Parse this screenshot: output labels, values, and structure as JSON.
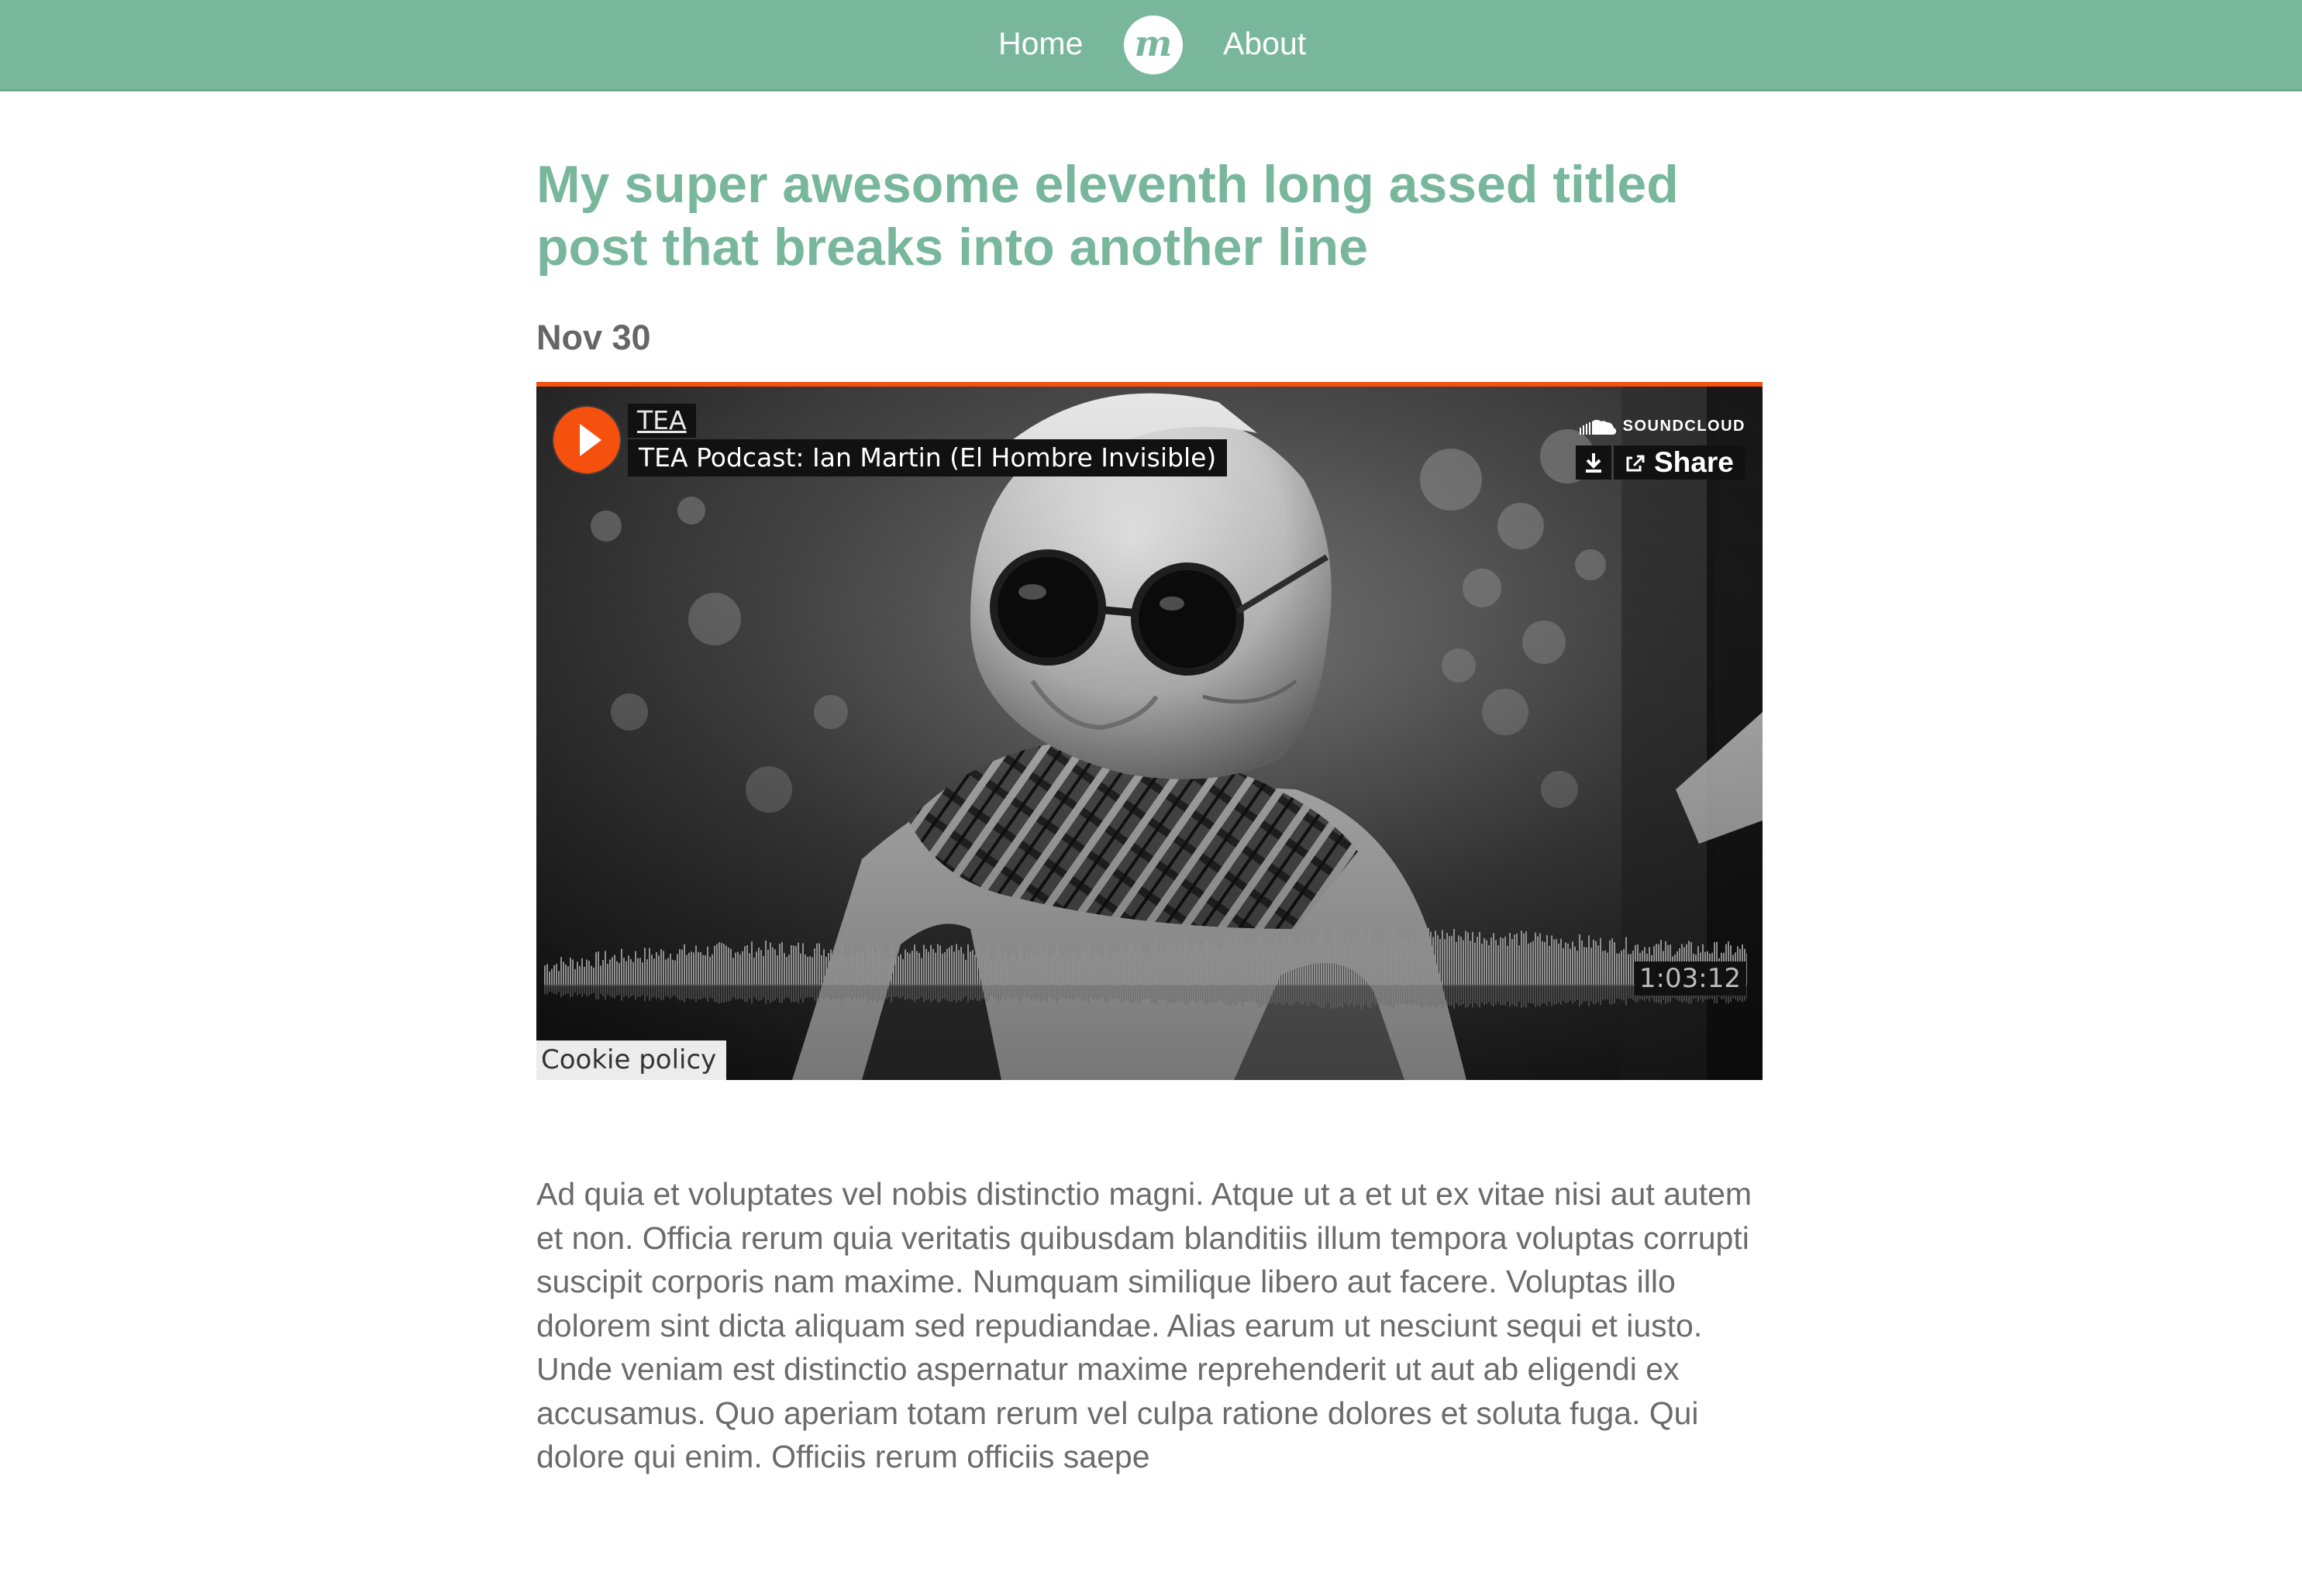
{
  "nav": {
    "home_label": "Home",
    "about_label": "About",
    "logo_letter": "m",
    "background_color": "#79b79d"
  },
  "post": {
    "title": "My super awesome eleventh long assed titled post that breaks into another line",
    "date": "Nov 30",
    "body": "Ad quia et voluptates vel nobis distinctio magni. Atque ut a et ut ex vitae nisi aut autem et non. Officia rerum quia veritatis quibusdam blanditiis illum tempora voluptas corrupti suscipit corporis nam maxime. Numquam similique libero aut facere. Voluptas illo dolorem sint dicta aliquam sed repudiandae. Alias earum ut nesciunt sequi et iusto. Unde veniam est distinctio aspernatur maxime reprehenderit ut aut ab eligendi ex accusamus. Quo aperiam totam rerum vel culpa ratione dolores et soluta fuga. Qui dolore qui enim. Officiis rerum officiis saepe",
    "title_color": "#79b79d"
  },
  "player": {
    "user": "TEA",
    "track": "TEA Podcast: Ian Martin (El Hombre Invisible)",
    "brand": "SOUNDCLOUD",
    "share_label": "Share",
    "duration": "1:03:12",
    "cookie_label": "Cookie policy",
    "accent_color": "#f5500d",
    "icons": [
      "play-icon",
      "soundcloud-logo-icon",
      "download-icon",
      "share-icon"
    ]
  }
}
